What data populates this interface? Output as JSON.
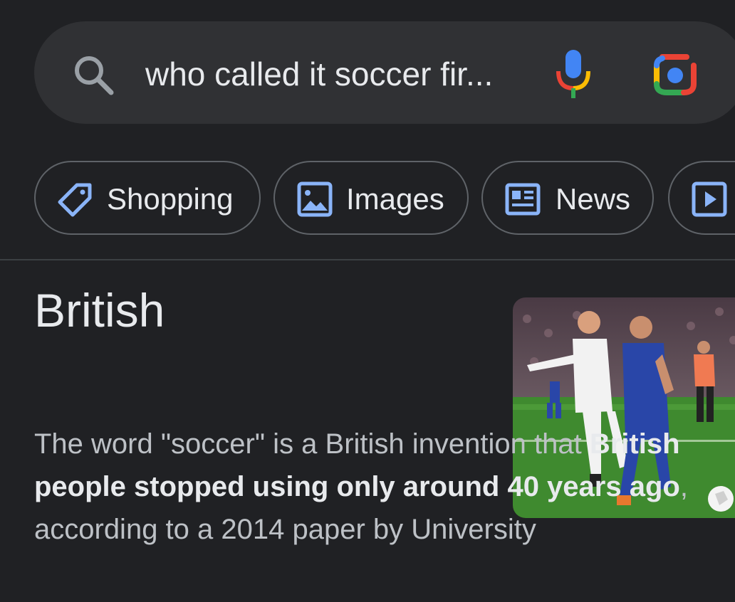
{
  "search": {
    "query": "who called it soccer fir..."
  },
  "chips": [
    {
      "label": "Shopping",
      "icon": "tag-icon"
    },
    {
      "label": "Images",
      "icon": "image-icon"
    },
    {
      "label": "News",
      "icon": "news-icon"
    },
    {
      "label": "",
      "icon": "video-icon"
    }
  ],
  "answer": {
    "title": "British",
    "image_alt": "soccer-match-photo",
    "snippet": {
      "part1": "The word \"soccer\" is a British invention that ",
      "bold": "British people stopped using only around 40 years ago",
      "part2": ", according to a 2014 paper by University"
    }
  },
  "colors": {
    "background": "#202124",
    "search_bg": "#303134",
    "chip_border": "#5f6368",
    "icon_blue": "#8ab4f8"
  }
}
